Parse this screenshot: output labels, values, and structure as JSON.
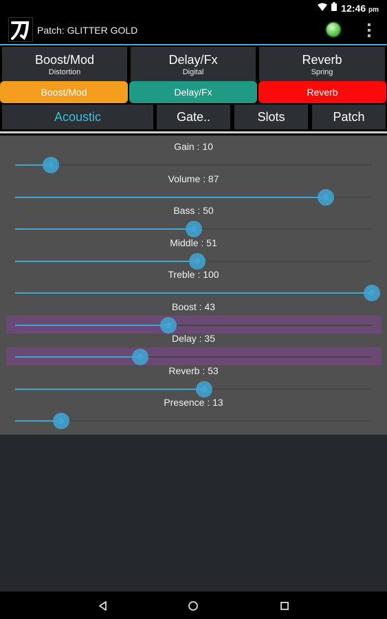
{
  "status_bar": {
    "time": "12:46",
    "ampm": "pm",
    "icons": [
      "wifi-icon",
      "battery-icon"
    ]
  },
  "header": {
    "patch_label": "Patch: GLITTER GOLD",
    "logo_icon": "katana-logo",
    "status_led": "green",
    "menu_icon": "overflow-menu-icon"
  },
  "effect_tabs": [
    {
      "title": "Boost/Mod",
      "subtitle": "Distortion"
    },
    {
      "title": "Delay/Fx",
      "subtitle": "Digital"
    },
    {
      "title": "Reverb",
      "subtitle": "Spring"
    }
  ],
  "effect_toggles": [
    {
      "label": "Boost/Mod",
      "color": "#f39c1e"
    },
    {
      "label": "Delay/Fx",
      "color": "#1f9a84"
    },
    {
      "label": "Reverb",
      "color": "#fb0a0a"
    }
  ],
  "sub_tabs": [
    {
      "label": "Acoustic",
      "active": true
    },
    {
      "label": "Gate..",
      "active": false
    },
    {
      "label": "Slots",
      "active": false
    },
    {
      "label": "Patch",
      "active": false
    }
  ],
  "parameters": [
    {
      "label": "Gain  : 10",
      "value": 10,
      "max": 100,
      "highlighted": false
    },
    {
      "label": "Volume  : 87",
      "value": 87,
      "max": 100,
      "highlighted": false
    },
    {
      "label": "Bass  : 50",
      "value": 50,
      "max": 100,
      "highlighted": false
    },
    {
      "label": "Middle  : 51",
      "value": 51,
      "max": 100,
      "highlighted": false
    },
    {
      "label": "Treble  : 100",
      "value": 100,
      "max": 100,
      "highlighted": false
    },
    {
      "label": "Boost : 43",
      "value": 43,
      "max": 100,
      "highlighted": true
    },
    {
      "label": "Delay : 35",
      "value": 35,
      "max": 100,
      "highlighted": true
    },
    {
      "label": "Reverb  : 53",
      "value": 53,
      "max": 100,
      "highlighted": false
    },
    {
      "label": "Presence  : 13",
      "value": 13,
      "max": 100,
      "highlighted": false
    }
  ],
  "colors": {
    "accent": "#3fa7d6",
    "active_tab_text": "#34c1d9",
    "highlight": "#6a4a74"
  },
  "nav": {
    "icons": [
      "back-icon",
      "home-icon",
      "recents-icon"
    ]
  }
}
